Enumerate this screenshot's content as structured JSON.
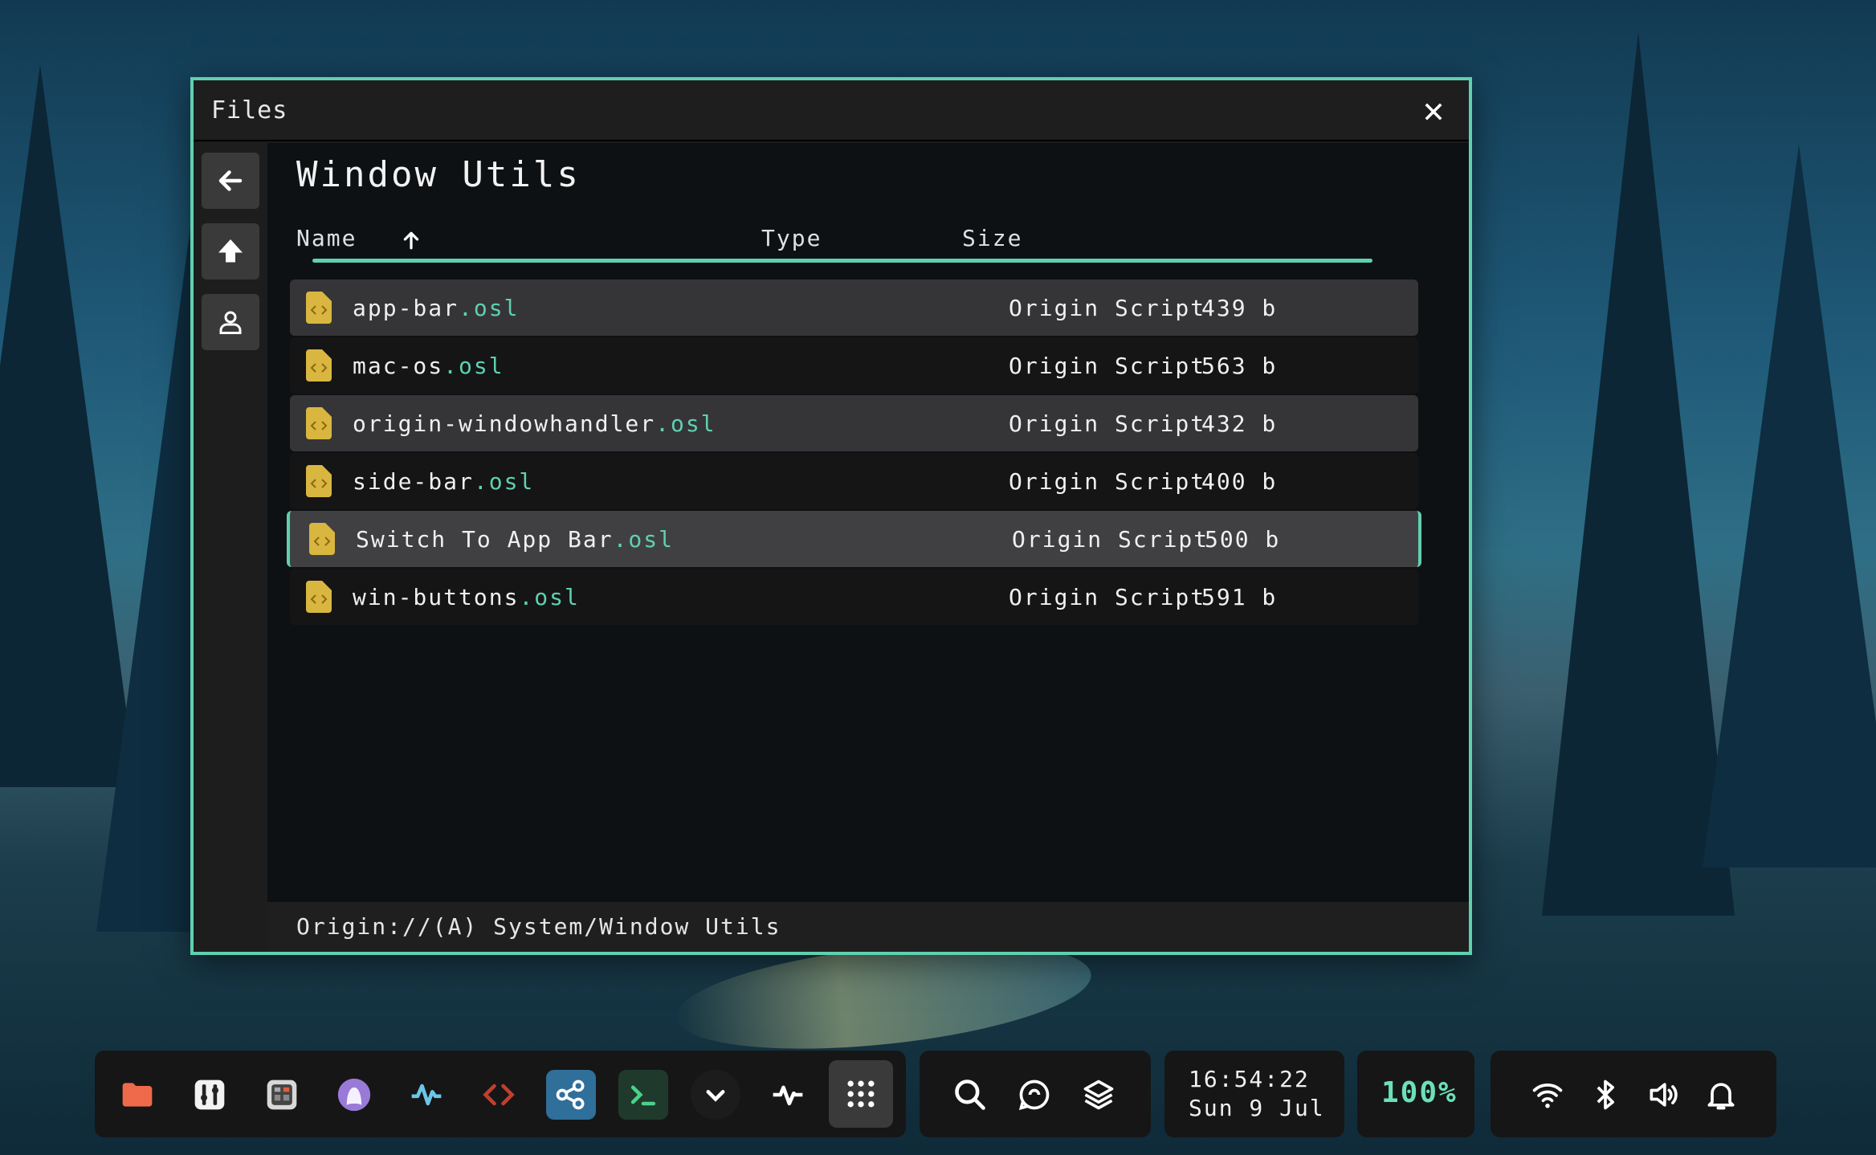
{
  "window": {
    "title": "Files",
    "close_label": "✕",
    "page_title": "Window Utils",
    "columns": {
      "name": "Name",
      "type": "Type",
      "size": "Size"
    },
    "files": [
      {
        "base": "app-bar",
        "ext": ".osl",
        "type": "Origin Script",
        "size": "439 b"
      },
      {
        "base": "mac-os",
        "ext": ".osl",
        "type": "Origin Script",
        "size": "563 b"
      },
      {
        "base": "origin-windowhandler",
        "ext": ".osl",
        "type": "Origin Script",
        "size": "432 b"
      },
      {
        "base": "side-bar",
        "ext": ".osl",
        "type": "Origin Script",
        "size": "400 b"
      },
      {
        "base": "Switch To App Bar",
        "ext": ".osl",
        "type": "Origin Script",
        "size": "500 b"
      },
      {
        "base": "win-buttons",
        "ext": ".osl",
        "type": "Origin Script",
        "size": "591 b"
      }
    ],
    "selected_index": 4,
    "status_path": "Origin://(A) System/Window Utils"
  },
  "sidebar": {
    "icons": [
      "back-arrow-icon",
      "up-arrow-icon",
      "user-icon"
    ]
  },
  "taskbar": {
    "apps": [
      "folder-icon",
      "tools-icon",
      "calculator-icon",
      "ghost-icon",
      "activity-icon",
      "code-icon",
      "share-icon",
      "terminal-icon",
      "chevron-down-icon",
      "pulse-icon",
      "app-grid-icon"
    ],
    "quick": [
      "search-icon",
      "chat-icon",
      "layers-icon"
    ],
    "time": "16:54:22",
    "date": "Sun 9 Jul",
    "battery": "100%",
    "system": [
      "wifi-icon",
      "bluetooth-icon",
      "volume-icon",
      "bell-icon"
    ]
  },
  "colors": {
    "accent": "#5fd0b0",
    "window_bg": "#1b1b1c",
    "file_icon": "#d9b640"
  }
}
